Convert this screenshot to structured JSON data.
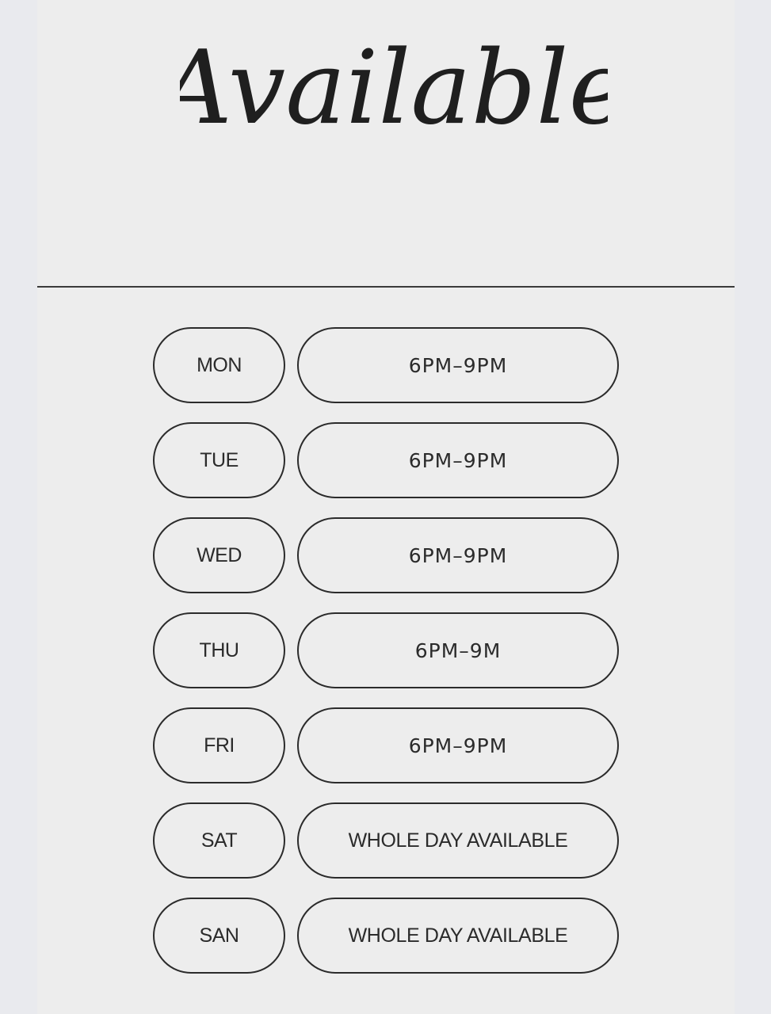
{
  "title": "Available",
  "schedule": [
    {
      "day": "MON",
      "time": "6PM–9PM"
    },
    {
      "day": "TUE",
      "time": "6PM–9PM"
    },
    {
      "day": "WED",
      "time": "6PM–9PM"
    },
    {
      "day": "THU",
      "time": "6PM–9M"
    },
    {
      "day": "FRI",
      "time": "6PM–9PM"
    },
    {
      "day": "SAT",
      "time": "WHOLE DAY AVAILABLE"
    },
    {
      "day": "SAN",
      "time": "WHOLE DAY AVAILABLE"
    }
  ]
}
